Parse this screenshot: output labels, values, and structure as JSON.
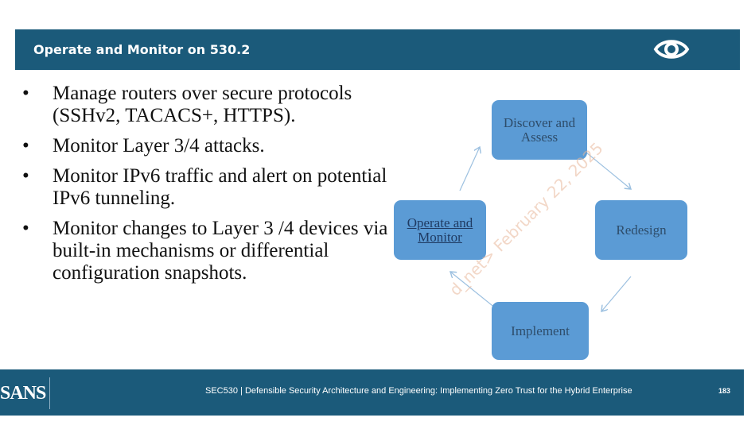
{
  "header": {
    "title": "Operate and Monitor on 530.2",
    "icon": "eye-icon"
  },
  "bullets": [
    "Manage routers over secure protocols (SSHv2, TACACS+, HTTPS).",
    "Monitor Layer 3/4 attacks.",
    "Monitor IPv6 traffic and alert on potential IPv6 tunneling.",
    "Monitor changes to Layer 3 /4 devices via built-in mechanisms or differential configuration snapshots."
  ],
  "bullet_marker": "•",
  "diagram": {
    "nodes": [
      {
        "label": "Discover and Assess"
      },
      {
        "label": "Redesign"
      },
      {
        "label": "Implement"
      },
      {
        "label": "Operate and Monitor"
      }
    ],
    "node_color": "#5b9bd5"
  },
  "watermark": "d_net> February 22, 2025",
  "footer": {
    "logo": "SANS",
    "text": "SEC530 | Defensible Security Architecture and Engineering: Implementing Zero Trust for the Hybrid Enterprise",
    "page": "183"
  },
  "colors": {
    "brand": "#1b5a7a",
    "node": "#5b9bd5"
  }
}
